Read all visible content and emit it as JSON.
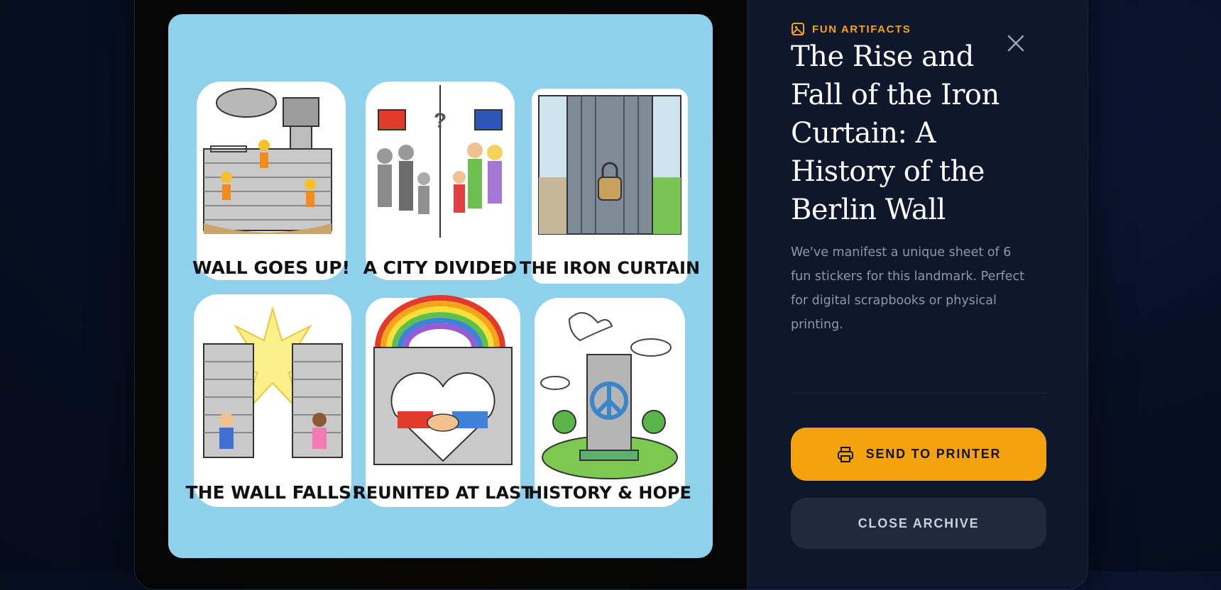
{
  "artifact": {
    "eyebrow": "FUN ARTIFACTS",
    "eyebrow_icon": "image-icon",
    "title": "The Rise and Fall of the Iron Curtain: A History of the Berlin Wall",
    "description": "We've manifest a unique sheet of 6 fun stickers for this landmark. Perfect for digital scrapbooks or physical printing."
  },
  "stickers": [
    {
      "label": "WALL GOES UP!",
      "art": "construction-workers-building-wall"
    },
    {
      "label": "A CITY DIVIDED",
      "art": "families-split-by-flags"
    },
    {
      "label": "THE IRON CURTAIN",
      "art": "padlocked-curtain"
    },
    {
      "label": "THE WALL FALLS!",
      "art": "people-breaking-wall"
    },
    {
      "label": "REUNITED AT LAST",
      "art": "handshake-heart-rainbow"
    },
    {
      "label": "HISTORY & HOPE",
      "art": "peace-monument-dove"
    }
  ],
  "actions": {
    "print_label": "SEND TO PRINTER",
    "print_icon": "printer-icon",
    "close_label": "CLOSE ARCHIVE",
    "close_icon": "close-icon"
  },
  "colors": {
    "accent": "#f5a20f",
    "sheet_background": "#8fd0ec",
    "panel": "#0e172b"
  }
}
